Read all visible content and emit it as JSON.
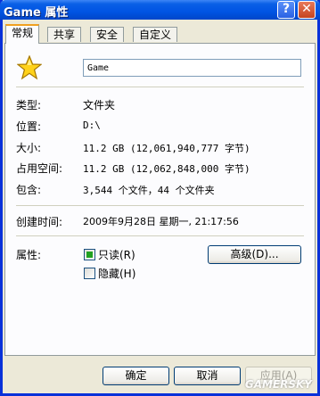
{
  "window": {
    "title": "Game 属性"
  },
  "titlebar": {
    "help_label": "?",
    "close_label": "✕"
  },
  "tabs": [
    {
      "label": "常规",
      "active": true
    },
    {
      "label": "共享",
      "active": false
    },
    {
      "label": "安全",
      "active": false
    },
    {
      "label": "自定义",
      "active": false
    }
  ],
  "general": {
    "folder_name": "Game",
    "icon": "folder-star-icon",
    "type_label": "类型:",
    "type_value": "文件夹",
    "location_label": "位置:",
    "location_value": "D:\\",
    "size_label": "大小:",
    "size_value": "11.2 GB (12,061,940,777 字节)",
    "size_on_disk_label": "占用空间:",
    "size_on_disk_value": "11.2 GB (12,062,848,000 字节)",
    "contains_label": "包含:",
    "contains_value": "3,544 个文件，44 个文件夹",
    "created_label": "创建时间:",
    "created_value": "2009年9月28日 星期一, 21:17:56",
    "attributes_label": "属性:",
    "readonly_label": "只读(R)",
    "readonly_checked": true,
    "hidden_label": "隐藏(H)",
    "hidden_checked": false,
    "advanced_button": "高级(D)..."
  },
  "footer": {
    "ok": "确定",
    "cancel": "取消",
    "apply": "应用(A)"
  },
  "watermark": "GAMERSKY",
  "colors": {
    "title_bar": "#0054e3",
    "window_frame": "#0831d9",
    "dialog_bg": "#ece9d8",
    "tab_accent": "#f0a020"
  }
}
